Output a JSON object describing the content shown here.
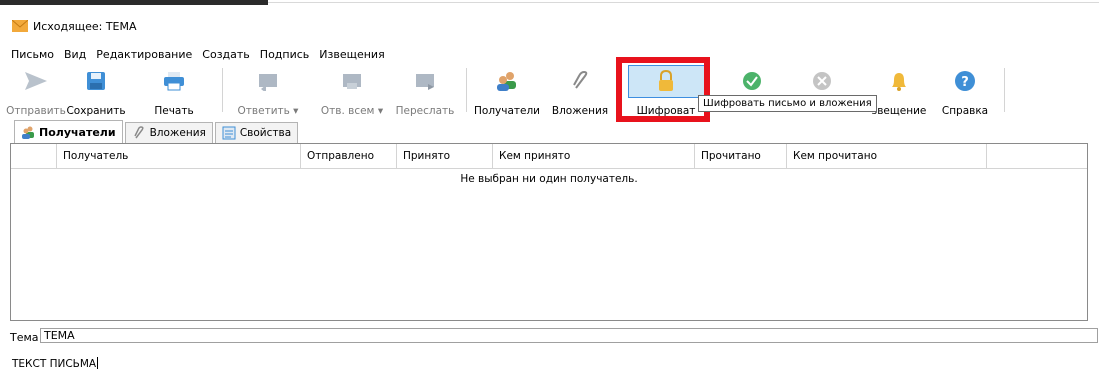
{
  "window": {
    "title": "Исходящее: ТЕМА",
    "icon": "envelope-icon"
  },
  "menu": {
    "items": [
      "Письмо",
      "Вид",
      "Редактирование",
      "Создать",
      "Подпись",
      "Извещения"
    ]
  },
  "toolbar": {
    "send": {
      "label": "Отправить",
      "icon": "send-arrow-icon"
    },
    "save": {
      "label": "Сохранить",
      "icon": "save-disk-icon"
    },
    "print": {
      "label": "Печать",
      "icon": "printer-icon"
    },
    "reply": {
      "label": "Ответить",
      "dropdown": "▾",
      "icon": "reply-icon"
    },
    "reply_all": {
      "label": "Отв. всем",
      "dropdown": "▾",
      "icon": "reply-all-icon"
    },
    "forward": {
      "label": "Переслать",
      "icon": "forward-icon"
    },
    "recipients": {
      "label": "Получатели",
      "icon": "users-icon"
    },
    "attachments": {
      "label": "Вложения",
      "icon": "paperclip-icon"
    },
    "encrypt": {
      "label": "Шифроват",
      "icon": "lock-icon"
    },
    "sign": {
      "icon": "check-badge-icon"
    },
    "cancel_sign": {
      "icon": "x-badge-icon"
    },
    "notice": {
      "label": "звещение",
      "icon": "bell-icon"
    },
    "help": {
      "label": "Справка",
      "icon": "help-icon"
    }
  },
  "tooltip": {
    "text": "Шифровать письмо и вложения"
  },
  "tabs": [
    {
      "label": "Получатели",
      "icon": "users-icon"
    },
    {
      "label": "Вложения",
      "icon": "paperclip-icon"
    },
    {
      "label": "Свойства",
      "icon": "properties-icon"
    }
  ],
  "grid": {
    "columns": [
      "Получатель",
      "Отправлено",
      "Принято",
      "Кем принято",
      "Прочитано",
      "Кем прочитано"
    ],
    "empty_text": "Не выбран ни один получатель."
  },
  "subject": {
    "label": "Тема",
    "value": "ТЕМА"
  },
  "message": {
    "body": "ТЕКСТ ПИСЬМА"
  },
  "colors": {
    "highlight": "#e8121c",
    "active_button": "#cde6f7"
  }
}
